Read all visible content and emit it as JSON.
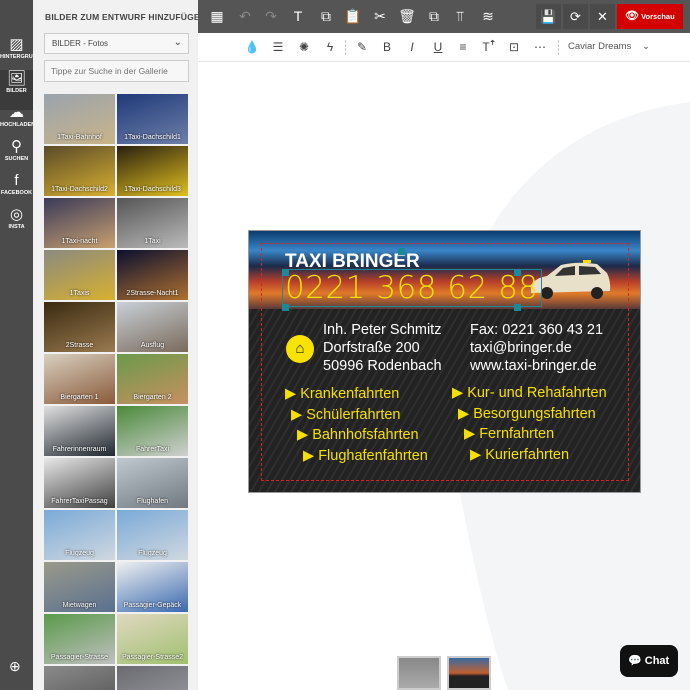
{
  "rail": [
    {
      "label": "HINTERGRUND",
      "icon": "background-stripes-icon",
      "glyph": "▨"
    },
    {
      "label": "BILDER",
      "icon": "image-icon",
      "glyph": "🖼"
    },
    {
      "label": "HOCHLADEN",
      "icon": "upload-cloud-icon",
      "glyph": "☁"
    },
    {
      "label": "SUCHEN",
      "icon": "search-icon",
      "glyph": "⚲"
    },
    {
      "label": "FACEBOOK",
      "icon": "facebook-icon",
      "glyph": "f"
    },
    {
      "label": "INSTA",
      "icon": "instagram-icon",
      "glyph": "◎"
    }
  ],
  "rail_zoom_icon": "⊕",
  "panel": {
    "title": "BILDER ZUM ENTWURF HINZUFÜGEN",
    "select_value": "BILDER - Fotos",
    "search_placeholder": "Tippe zur Suche in der Gallerie",
    "tiles": [
      {
        "label": "1Taxi-Bahnhof",
        "c1": "#9aa3ad",
        "c2": "#c9b48a"
      },
      {
        "label": "1Taxi-Dachschild1",
        "c1": "#1f3a7a",
        "c2": "#6d7fa8"
      },
      {
        "label": "1Taxi-Dachschild2",
        "c1": "#5a4a2a",
        "c2": "#d8b030"
      },
      {
        "label": "1Taxi-Dachschild3",
        "c1": "#2a2010",
        "c2": "#e0c020"
      },
      {
        "label": "1Taxi-nacht",
        "c1": "#3a3a5a",
        "c2": "#c8a070"
      },
      {
        "label": "1Taxi",
        "c1": "#555",
        "c2": "#bbb"
      },
      {
        "label": "1Taxis",
        "c1": "#8a8a80",
        "c2": "#d8b030"
      },
      {
        "label": "2Strasse-Nacht1",
        "c1": "#0a1030",
        "c2": "#b07030"
      },
      {
        "label": "2Strasse",
        "c1": "#3a2a10",
        "c2": "#9a7a50"
      },
      {
        "label": "Ausflug",
        "c1": "#c8d0d8",
        "c2": "#7a6a5a"
      },
      {
        "label": "Biergarten 1",
        "c1": "#d8d0c0",
        "c2": "#8a5a3a"
      },
      {
        "label": "Biergarten 2",
        "c1": "#6a9a4a",
        "c2": "#c89060"
      },
      {
        "label": "Fahrerinnenraum",
        "c1": "#e0e0e0",
        "c2": "#202830"
      },
      {
        "label": "FahrerTaxi",
        "c1": "#4a8a3a",
        "c2": "#d0d0d0"
      },
      {
        "label": "FahrerTaxiPassag",
        "c1": "#e8e8e8",
        "c2": "#404040"
      },
      {
        "label": "Flughafen",
        "c1": "#c0c8d0",
        "c2": "#707880"
      },
      {
        "label": "Flugzeug",
        "c1": "#7aaad8",
        "c2": "#d0d8e0"
      },
      {
        "label": "Flugzeug",
        "c1": "#7aaad8",
        "c2": "#d0d8e0"
      },
      {
        "label": "Mietwagen",
        "c1": "#9a9a8a",
        "c2": "#5a7090"
      },
      {
        "label": "Passagier-Gepäck",
        "c1": "#f0f0f0",
        "c2": "#3a6ab0"
      },
      {
        "label": "Passagier-Strasse",
        "c1": "#5a9a4a",
        "c2": "#c0c0c0"
      },
      {
        "label": "Passagier-Strasse2",
        "c1": "#e0d8c0",
        "c2": "#a0c070"
      },
      {
        "label": "",
        "c1": "#8a8a8a",
        "c2": "#505050"
      },
      {
        "label": "",
        "c1": "#6a6a70",
        "c2": "#a0a0a8"
      }
    ]
  },
  "toolbar": {
    "icons": [
      {
        "name": "qr-code-icon",
        "glyph": "▦",
        "disabled": false
      },
      {
        "name": "undo-icon",
        "glyph": "↶",
        "disabled": true
      },
      {
        "name": "redo-icon",
        "glyph": "↷",
        "disabled": true
      },
      {
        "name": "add-text-icon",
        "glyph": "T",
        "disabled": false
      },
      {
        "name": "add-shape-icon",
        "glyph": "⧉",
        "disabled": false
      },
      {
        "name": "paste-icon",
        "glyph": "📋",
        "disabled": true
      },
      {
        "name": "cut-icon",
        "glyph": "✂",
        "disabled": false
      },
      {
        "name": "delete-icon",
        "glyph": "🗑",
        "disabled": false
      },
      {
        "name": "duplicate-icon",
        "glyph": "⧉",
        "disabled": false
      },
      {
        "name": "align-top-icon",
        "glyph": "⫪",
        "disabled": false
      },
      {
        "name": "layers-icon",
        "glyph": "≋",
        "disabled": false
      }
    ],
    "boxes": [
      {
        "name": "save-button",
        "glyph": "💾"
      },
      {
        "name": "refresh-button",
        "glyph": "⟳"
      },
      {
        "name": "close-button",
        "glyph": "✕"
      }
    ],
    "preview_label": "Vorschau",
    "preview_color": "#d40000"
  },
  "format": {
    "icons": [
      {
        "name": "color-drop-icon",
        "glyph": "💧"
      },
      {
        "name": "line-spacing-icon",
        "glyph": "☰"
      },
      {
        "name": "effects-icon",
        "glyph": "✺"
      },
      {
        "name": "lightning-icon",
        "glyph": "ϟ"
      },
      {
        "name": "pen-icon",
        "glyph": "✎"
      },
      {
        "name": "bold-icon",
        "glyph": "B"
      },
      {
        "name": "italic-icon",
        "glyph": "I"
      },
      {
        "name": "underline-icon",
        "glyph": "U"
      },
      {
        "name": "align-left-icon",
        "glyph": "≡"
      },
      {
        "name": "font-size-icon",
        "glyph": "Tꜛ"
      },
      {
        "name": "text-box-icon",
        "glyph": "⊡"
      },
      {
        "name": "more-icon",
        "glyph": "⋯"
      }
    ],
    "font": "Caviar Dreams"
  },
  "card": {
    "title": "TAXI BRINGER",
    "phone": "0221 368 62 88",
    "owner": "Inh. Peter Schmitz",
    "street": "Dorfstraße 200",
    "city": "50996 Rodenbach",
    "fax": "Fax: 0221 360 43 21",
    "email": "taxi@bringer.de",
    "web": "www.taxi-bringer.de",
    "services_left": [
      "Krankenfahrten",
      "Schülerfahrten",
      "Bahnhofsfahrten",
      "Flughafenfahrten"
    ],
    "services_right": [
      "Kur- und Rehafahrten",
      "Besorgungsfahrten",
      "Fernfahrten",
      "Kurierfahrten"
    ],
    "accent": "#f5e000"
  },
  "chat_label": "Chat"
}
